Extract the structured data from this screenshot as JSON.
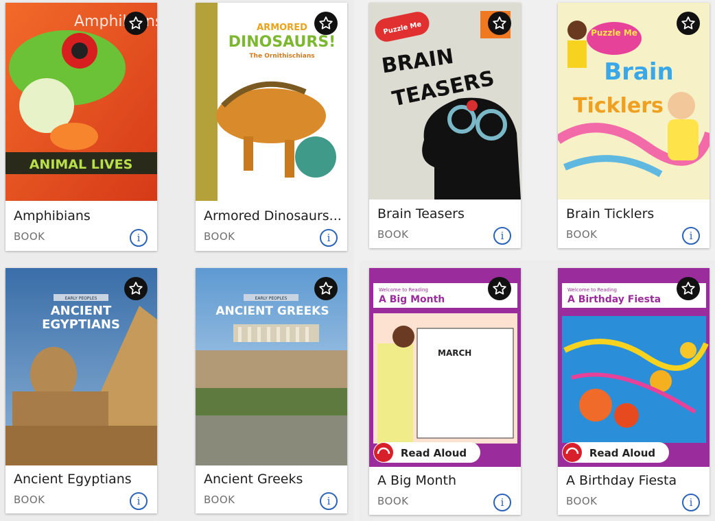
{
  "books": [
    {
      "title": "Amphibians",
      "type": "BOOK",
      "cover_text": {
        "top": "Amphibians",
        "band": "ANIMAL LIVES"
      }
    },
    {
      "title": "Armored Dinosaurs...",
      "type": "BOOK",
      "cover_text": {
        "top": "ARMORED",
        "main": "DINOSAURS!",
        "sub": "The Ornithischians"
      }
    },
    {
      "title": "Brain Teasers",
      "type": "BOOK",
      "cover_text": {
        "badge": "Puzzle Me",
        "line1": "BRAIN",
        "line2": "TEASERS"
      }
    },
    {
      "title": "Brain Ticklers",
      "type": "BOOK",
      "cover_text": {
        "badge": "Puzzle Me",
        "line1": "Brain",
        "line2": "Ticklers"
      }
    },
    {
      "title": "Ancient Egyptians",
      "type": "BOOK",
      "cover_text": {
        "series": "EARLY PEOPLES",
        "line1": "ANCIENT",
        "line2": "EGYPTIANS"
      }
    },
    {
      "title": "Ancient Greeks",
      "type": "BOOK",
      "cover_text": {
        "series": "EARLY PEOPLES",
        "line1": "ANCIENT GREEKS"
      }
    },
    {
      "title": "A Big Month",
      "type": "BOOK",
      "cover_text": {
        "series": "Welcome to Reading",
        "line1": "A Big Month",
        "month": "MARCH",
        "read_aloud": "Read Aloud"
      }
    },
    {
      "title": "A Birthday Fiesta",
      "type": "BOOK",
      "cover_text": {
        "series": "Welcome to Reading",
        "line1": "A Birthday Fiesta",
        "read_aloud": "Read Aloud"
      }
    }
  ],
  "icons": {
    "favorite": "star-outline-icon",
    "info": "info-icon"
  },
  "colors": {
    "info_blue": "#2a63b8",
    "card_bg": "#ffffff",
    "label_gray": "#6e6e6e"
  }
}
